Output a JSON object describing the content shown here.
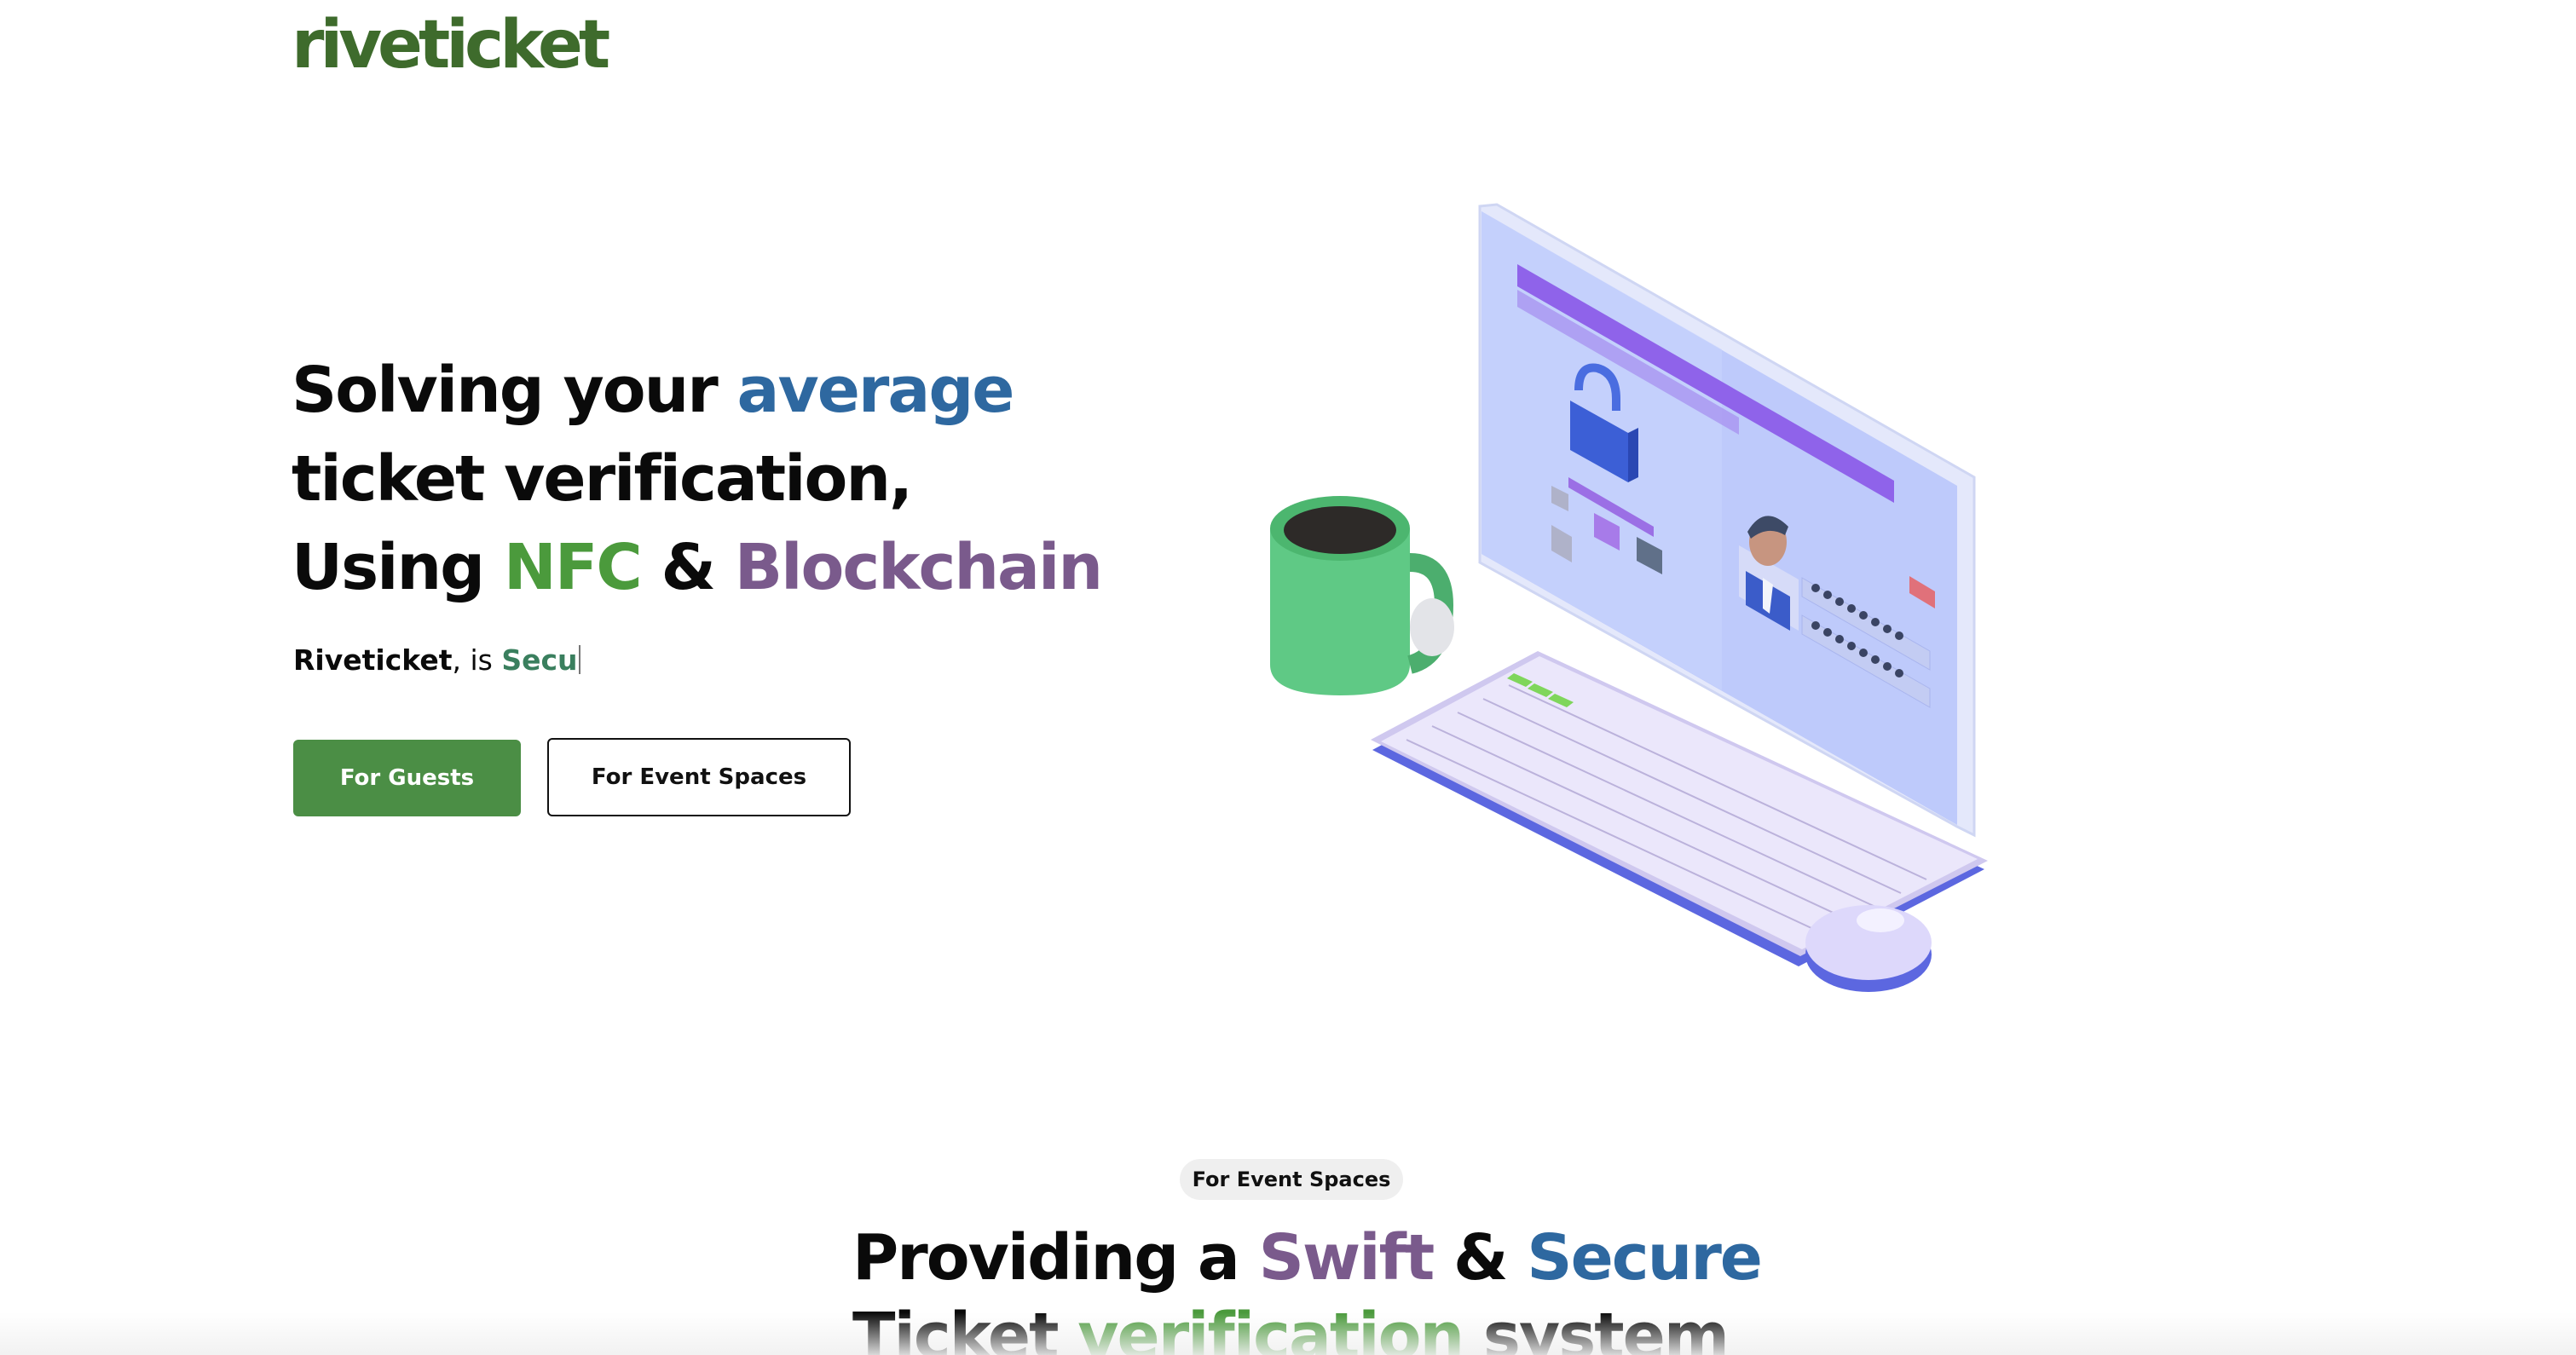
{
  "brand": {
    "logo_text": "riveticket",
    "logo_color": "#3e6b2c"
  },
  "colors": {
    "blue": "#2e68a0",
    "green": "#4b9a3c",
    "purple": "#7a5a8c",
    "teal": "#3a7f5e",
    "button_green": "#4b8e45"
  },
  "hero": {
    "line1_a": "Solving your ",
    "line1_b": "average",
    "line2": "ticket verification,",
    "line3_a": "Using ",
    "line3_b": "NFC",
    "line3_c": " & ",
    "line3_d": "Blockchain",
    "tagline_brand": "Riveticket",
    "tagline_mid": ", is ",
    "tagline_typed": "Secu"
  },
  "buttons": {
    "guests": "For Guests",
    "event_spaces": "For Event Spaces"
  },
  "section2": {
    "badge": "For Event Spaces",
    "line1_a": "Providing a ",
    "line1_b": "Swift",
    "line1_c": " & ",
    "line1_d": "Secure",
    "line2_a": "Ticket ",
    "line2_b": "verification",
    "line2_c": " system"
  },
  "illustration": {
    "icons": [
      "coffee-mug-icon",
      "monitor-icon",
      "padlock-icon",
      "user-avatar-icon",
      "keyboard-icon",
      "mouse-icon"
    ]
  }
}
